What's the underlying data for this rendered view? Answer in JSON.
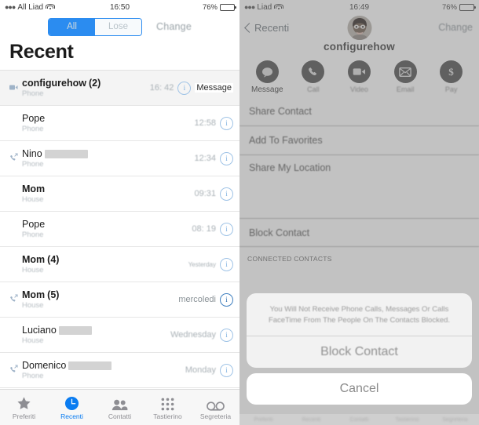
{
  "left": {
    "status_bar": {
      "carrier": "All Liad",
      "wifi_icon": "wifi-icon",
      "time": "16:50",
      "battery_text": "76%",
      "battery_icon": "battery-icon"
    },
    "segmented": {
      "option_all": "All",
      "option_lose": "Lose",
      "selected": "All",
      "accent": "#2b8cf0"
    },
    "change_link": "Change",
    "title": "Recent",
    "rows": [
      {
        "icon": "video-call-icon",
        "name": "configurehow",
        "count": "(2)",
        "bold": true,
        "redacted": false,
        "sub": "Phone",
        "time": "16: 42",
        "time_small": false,
        "info": "(1)",
        "shaded": true,
        "trailing": "Message"
      },
      {
        "icon": "",
        "name": "Pope",
        "count": "",
        "bold": false,
        "redacted": false,
        "sub": "Phone",
        "time": "12:58",
        "time_small": false,
        "info": "(1)",
        "shaded": false
      },
      {
        "icon": "outgoing-call-icon",
        "name": "Nino",
        "count": "",
        "bold": false,
        "redacted": true,
        "sub": "Phone",
        "time": "12:34",
        "time_small": false,
        "info": "(1)",
        "shaded": false
      },
      {
        "icon": "",
        "name": "Mom",
        "count": "",
        "bold": true,
        "redacted": false,
        "sub": "House",
        "time": "09:31",
        "time_small": false,
        "info": "(1)",
        "shaded": false
      },
      {
        "icon": "",
        "name": "Pope",
        "count": "",
        "bold": false,
        "redacted": false,
        "sub": "Phone",
        "time": "08: 19",
        "time_small": false,
        "info": "(D)",
        "shaded": false
      },
      {
        "icon": "",
        "name": "Mom",
        "count": "(4)",
        "bold": true,
        "redacted": false,
        "sub": "House",
        "time": "Yesterday",
        "time_small": true,
        "info": "(1)",
        "shaded": false
      },
      {
        "icon": "outgoing-call-icon",
        "name": "Mom",
        "count": "(5)",
        "bold": true,
        "redacted": false,
        "sub": "House",
        "time": "mercoledi",
        "time_small": false,
        "info": "(i)",
        "shaded": false,
        "crisp": true
      },
      {
        "icon": "",
        "name": "Luciano",
        "count": "",
        "bold": false,
        "redacted": true,
        "sub": "House",
        "time": "Wednesday",
        "time_small": false,
        "info": "(i)",
        "shaded": false
      },
      {
        "icon": "outgoing-call-icon",
        "name": "Domenico",
        "count": "",
        "bold": false,
        "redacted": true,
        "sub": "Phone",
        "time": "Monday",
        "time_small": false,
        "info": "(s)",
        "shaded": false
      }
    ],
    "tabs": [
      {
        "label": "Preferiti",
        "icon": "star-icon",
        "active": false
      },
      {
        "label": "Recenti",
        "icon": "clock-icon",
        "active": true
      },
      {
        "label": "Contatti",
        "icon": "people-icon",
        "active": false
      },
      {
        "label": "Tastierino",
        "icon": "keypad-icon",
        "active": false
      },
      {
        "label": "Segreteria",
        "icon": "voicemail-icon",
        "active": false
      }
    ]
  },
  "right": {
    "status_bar": {
      "carrier": "Liad",
      "wifi_icon": "wifi-icon",
      "time": "16:49",
      "battery_text": "76%",
      "battery_icon": "battery-icon"
    },
    "back_label": "Recenti",
    "nav_right": "Change",
    "contact_name": "configurehow",
    "avatar_icon": "contact-avatar",
    "actions": [
      {
        "label": "Message",
        "icon": "message-bubble-icon",
        "highlighted": true
      },
      {
        "label": "Call",
        "icon": "phone-icon",
        "highlighted": false
      },
      {
        "label": "Video",
        "icon": "video-camera-icon",
        "highlighted": false
      },
      {
        "label": "Email",
        "icon": "envelope-icon",
        "highlighted": false
      },
      {
        "label": "Pay",
        "icon": "dollar-icon",
        "highlighted": false
      }
    ],
    "options": [
      {
        "label": "Share Contact"
      },
      {
        "label": "Add To Favorites"
      },
      {
        "label": "Share My Location"
      }
    ],
    "block_option": "Block Contact",
    "section_label": "CONNECTED CONTACTS",
    "sheet": {
      "message": "You Will Not Receive Phone Calls, Messages Or Calls FaceTime From The People On The Contacts Blocked.",
      "confirm_label": "Block Contact",
      "cancel_label": "Cancel"
    },
    "ghost_tabs": [
      "Preferiti",
      "Recenti",
      "Contatti",
      "Tastierino",
      "Segreteria"
    ]
  }
}
